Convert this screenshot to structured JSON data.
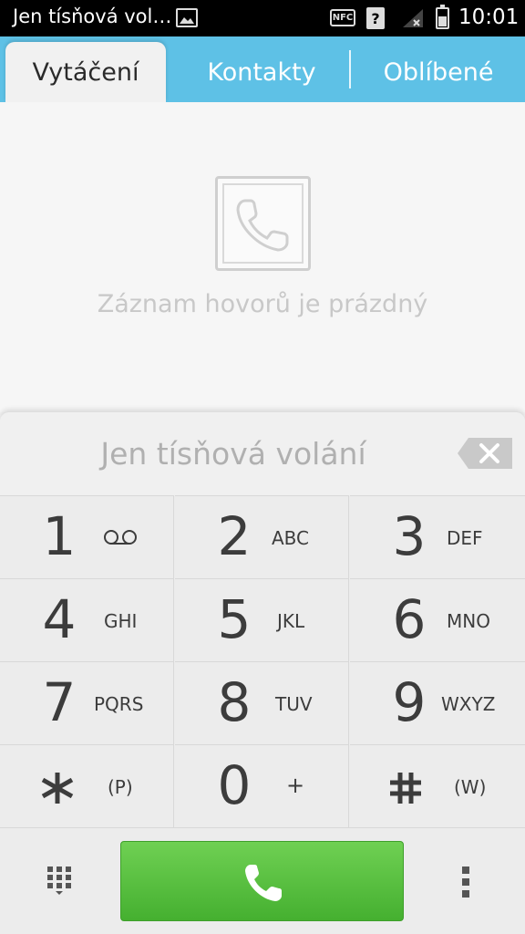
{
  "status_bar": {
    "notification_title": "Jen tísňová vol…",
    "nfc_label": "NFC",
    "sim_label": "?",
    "time": "10:01",
    "icons": [
      "image-icon",
      "nfc-icon",
      "sim-missing-icon",
      "signal-icon",
      "battery-icon"
    ]
  },
  "tabs": [
    {
      "label": "Vytáčení",
      "active": true
    },
    {
      "label": "Kontakty",
      "active": false
    },
    {
      "label": "Oblíbené",
      "active": false
    }
  ],
  "call_log": {
    "empty_message": "Záznam hovorů je prázdný",
    "icon": "phone-icon"
  },
  "dialpad": {
    "digits_display": "Jen tísňová volání",
    "backspace_icon": "backspace-icon",
    "keys": [
      {
        "digit": "1",
        "letters": "",
        "icon": "voicemail-icon"
      },
      {
        "digit": "2",
        "letters": "ABC"
      },
      {
        "digit": "3",
        "letters": "DEF"
      },
      {
        "digit": "4",
        "letters": "GHI"
      },
      {
        "digit": "5",
        "letters": "JKL"
      },
      {
        "digit": "6",
        "letters": "MNO"
      },
      {
        "digit": "7",
        "letters": "PQRS"
      },
      {
        "digit": "8",
        "letters": "TUV"
      },
      {
        "digit": "9",
        "letters": "WXYZ"
      },
      {
        "digit": "",
        "letters": "(P)",
        "icon": "asterisk-icon"
      },
      {
        "digit": "0",
        "letters": "+"
      },
      {
        "digit": "",
        "letters": "(W)",
        "icon": "hash-icon"
      }
    ],
    "bottom": {
      "left_icon": "dialpad-grid-icon",
      "call_icon": "call-icon",
      "right_icon": "more-vert-icon"
    }
  },
  "colors": {
    "tab_bar": "#5ec1e6",
    "call_button": "#52bd3a",
    "status_bar": "#000000"
  }
}
